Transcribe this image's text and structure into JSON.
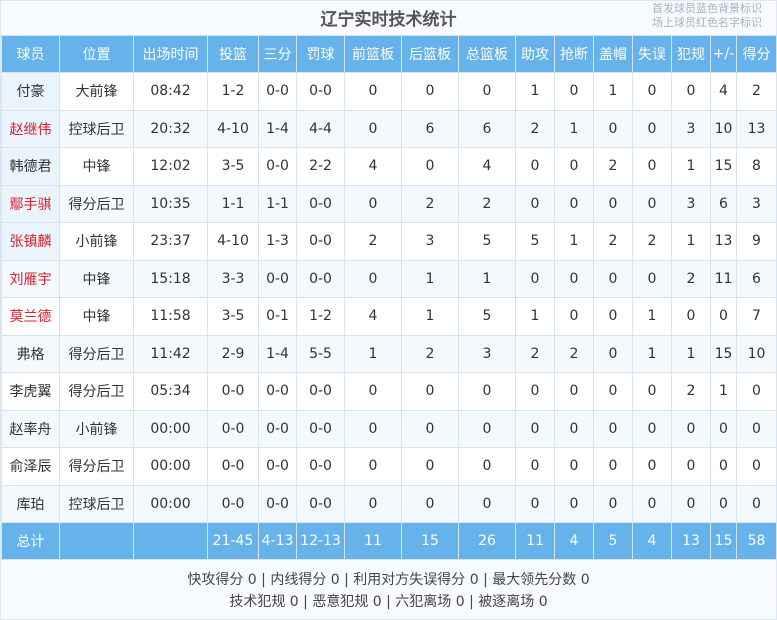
{
  "title": "辽宁实时技术统计",
  "legend": {
    "line1": "首发球员蓝色背景标识",
    "line2": "场上球员红色名字标识"
  },
  "columns": [
    "球员",
    "位置",
    "出场时间",
    "投篮",
    "三分",
    "罚球",
    "前篮板",
    "后篮板",
    "总篮板",
    "助攻",
    "抢断",
    "盖帽",
    "失误",
    "犯规",
    "+/-",
    "得分"
  ],
  "players": [
    {
      "name": "付豪",
      "pos": "大前锋",
      "min": "08:42",
      "fg": "1-2",
      "tp": "0-0",
      "ft": "0-0",
      "oreb": "0",
      "dreb": "0",
      "reb": "0",
      "ast": "1",
      "stl": "0",
      "blk": "1",
      "tov": "0",
      "pf": "0",
      "pm": "4",
      "pts": "2",
      "starter": true,
      "on_court": false
    },
    {
      "name": "赵继伟",
      "pos": "控球后卫",
      "min": "20:32",
      "fg": "4-10",
      "tp": "1-4",
      "ft": "4-4",
      "oreb": "0",
      "dreb": "6",
      "reb": "6",
      "ast": "2",
      "stl": "1",
      "blk": "0",
      "tov": "0",
      "pf": "3",
      "pm": "10",
      "pts": "13",
      "starter": true,
      "on_court": true
    },
    {
      "name": "韩德君",
      "pos": "中锋",
      "min": "12:02",
      "fg": "3-5",
      "tp": "0-0",
      "ft": "2-2",
      "oreb": "4",
      "dreb": "0",
      "reb": "4",
      "ast": "0",
      "stl": "0",
      "blk": "2",
      "tov": "0",
      "pf": "1",
      "pm": "15",
      "pts": "8",
      "starter": true,
      "on_court": false
    },
    {
      "name": "鄢手骐",
      "pos": "得分后卫",
      "min": "10:35",
      "fg": "1-1",
      "tp": "1-1",
      "ft": "0-0",
      "oreb": "0",
      "dreb": "2",
      "reb": "2",
      "ast": "0",
      "stl": "0",
      "blk": "0",
      "tov": "0",
      "pf": "3",
      "pm": "6",
      "pts": "3",
      "starter": true,
      "on_court": true
    },
    {
      "name": "张镇麟",
      "pos": "小前锋",
      "min": "23:37",
      "fg": "4-10",
      "tp": "1-3",
      "ft": "0-0",
      "oreb": "2",
      "dreb": "3",
      "reb": "5",
      "ast": "5",
      "stl": "1",
      "blk": "2",
      "tov": "2",
      "pf": "1",
      "pm": "13",
      "pts": "9",
      "starter": true,
      "on_court": true
    },
    {
      "name": "刘雁宇",
      "pos": "中锋",
      "min": "15:18",
      "fg": "3-3",
      "tp": "0-0",
      "ft": "0-0",
      "oreb": "0",
      "dreb": "1",
      "reb": "1",
      "ast": "0",
      "stl": "0",
      "blk": "0",
      "tov": "0",
      "pf": "2",
      "pm": "11",
      "pts": "6",
      "starter": false,
      "on_court": true
    },
    {
      "name": "莫兰德",
      "pos": "中锋",
      "min": "11:58",
      "fg": "3-5",
      "tp": "0-1",
      "ft": "1-2",
      "oreb": "4",
      "dreb": "1",
      "reb": "5",
      "ast": "1",
      "stl": "0",
      "blk": "0",
      "tov": "1",
      "pf": "0",
      "pm": "0",
      "pts": "7",
      "starter": false,
      "on_court": true
    },
    {
      "name": "弗格",
      "pos": "得分后卫",
      "min": "11:42",
      "fg": "2-9",
      "tp": "1-4",
      "ft": "5-5",
      "oreb": "1",
      "dreb": "2",
      "reb": "3",
      "ast": "2",
      "stl": "2",
      "blk": "0",
      "tov": "1",
      "pf": "1",
      "pm": "15",
      "pts": "10",
      "starter": false,
      "on_court": false
    },
    {
      "name": "李虎翼",
      "pos": "得分后卫",
      "min": "05:34",
      "fg": "0-0",
      "tp": "0-0",
      "ft": "0-0",
      "oreb": "0",
      "dreb": "0",
      "reb": "0",
      "ast": "0",
      "stl": "0",
      "blk": "0",
      "tov": "0",
      "pf": "2",
      "pm": "1",
      "pts": "0",
      "starter": false,
      "on_court": false
    },
    {
      "name": "赵率舟",
      "pos": "小前锋",
      "min": "00:00",
      "fg": "0-0",
      "tp": "0-0",
      "ft": "0-0",
      "oreb": "0",
      "dreb": "0",
      "reb": "0",
      "ast": "0",
      "stl": "0",
      "blk": "0",
      "tov": "0",
      "pf": "0",
      "pm": "0",
      "pts": "0",
      "starter": false,
      "on_court": false
    },
    {
      "name": "俞泽辰",
      "pos": "得分后卫",
      "min": "00:00",
      "fg": "0-0",
      "tp": "0-0",
      "ft": "0-0",
      "oreb": "0",
      "dreb": "0",
      "reb": "0",
      "ast": "0",
      "stl": "0",
      "blk": "0",
      "tov": "0",
      "pf": "0",
      "pm": "0",
      "pts": "0",
      "starter": false,
      "on_court": false
    },
    {
      "name": "库珀",
      "pos": "控球后卫",
      "min": "00:00",
      "fg": "0-0",
      "tp": "0-0",
      "ft": "0-0",
      "oreb": "0",
      "dreb": "0",
      "reb": "0",
      "ast": "0",
      "stl": "0",
      "blk": "0",
      "tov": "0",
      "pf": "0",
      "pm": "0",
      "pts": "0",
      "starter": false,
      "on_court": false
    }
  ],
  "totals": {
    "label": "总计",
    "fg": "21-45",
    "tp": "4-13",
    "ft": "12-13",
    "oreb": "11",
    "dreb": "15",
    "reb": "26",
    "ast": "11",
    "stl": "4",
    "blk": "5",
    "tov": "4",
    "pf": "13",
    "pm": "15",
    "pts": "58"
  },
  "footer": {
    "line1": "快攻得分 0 | 内线得分 0 | 利用对方失误得分 0 | 最大领先分数 0",
    "line2": "技术犯规 0 | 恶意犯规 0 | 六犯离场 0 | 被逐离场 0"
  },
  "colors": {
    "header_bg": "#66b2ea",
    "starter_bg": "#eaf4fd",
    "on_court_name": "#dd1f2a"
  }
}
